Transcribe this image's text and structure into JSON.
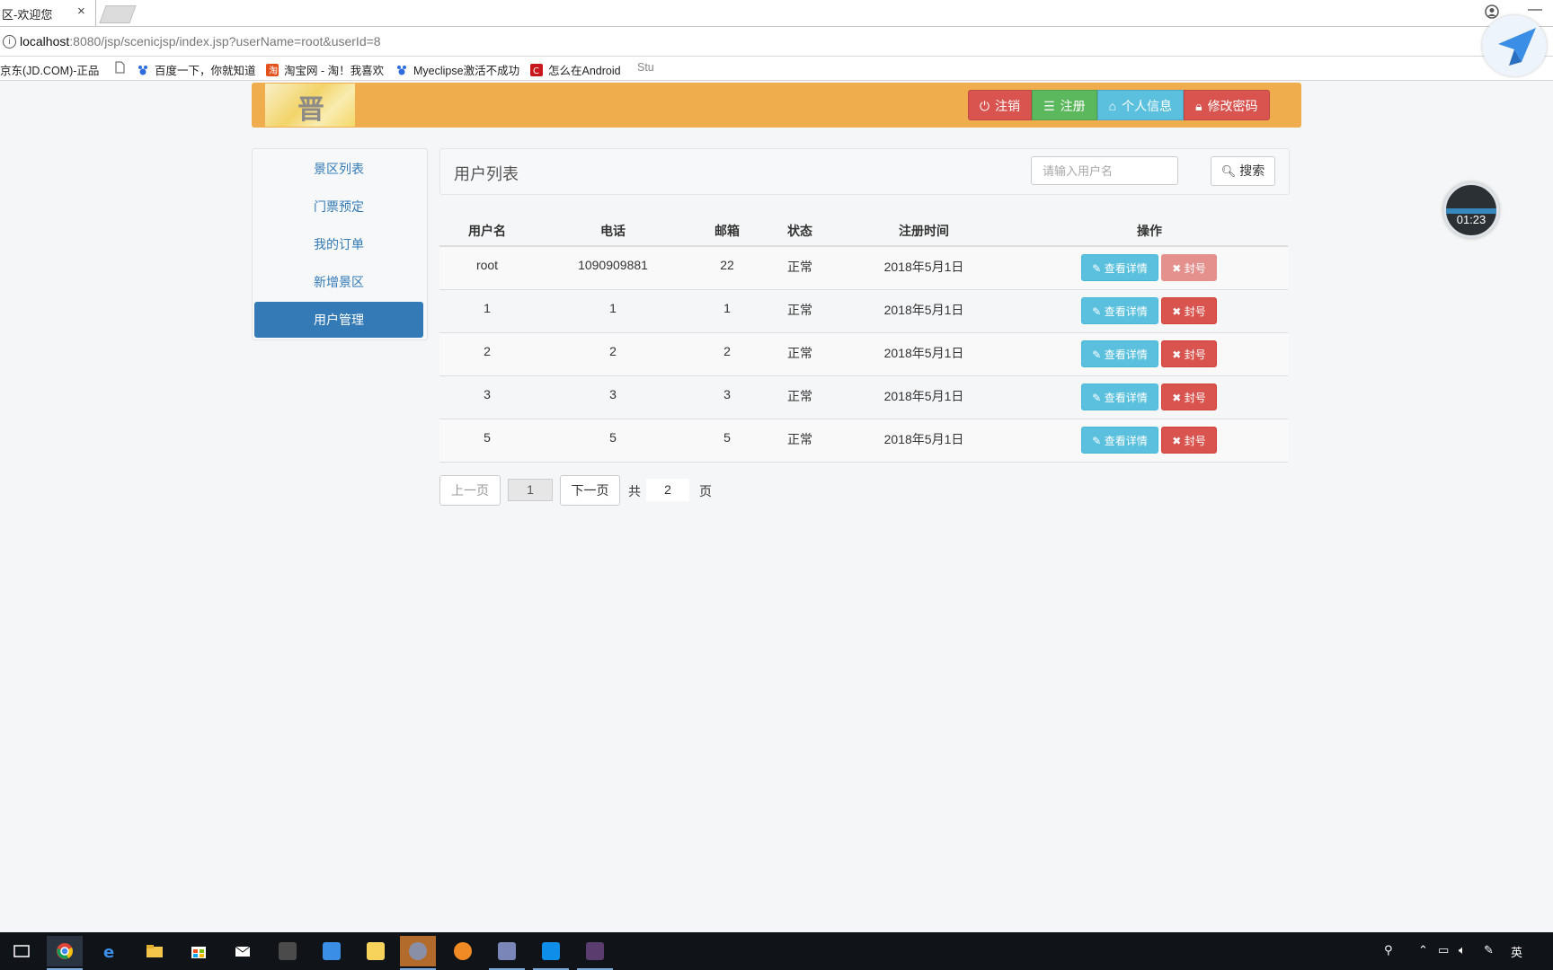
{
  "browser": {
    "tab_title": "区-欢迎您",
    "tab_close": "×",
    "url_host": "localhost",
    "url_rest": ":8080/jsp/scenicjsp/index.jsp?userName=root&userId=8",
    "bookmarks": [
      {
        "label": "京东(JD.COM)-正品",
        "icon": "jd-icon"
      },
      {
        "label": "",
        "icon": "page-icon"
      },
      {
        "label": "百度一下，你就知道",
        "icon": "baidu-icon"
      },
      {
        "label": "淘宝网 - 淘！我喜欢",
        "icon": "taobao-icon"
      },
      {
        "label": "Myeclipse激活不成功",
        "icon": "baidu-icon"
      },
      {
        "label": "怎么在Android",
        "icon": "csdn-icon"
      },
      {
        "label": "Stu",
        "icon": ""
      }
    ]
  },
  "timer": {
    "text": "01:23"
  },
  "header": {
    "logo_char": "晋",
    "buttons": {
      "logout": "注销",
      "register": "注册",
      "profile": "个人信息",
      "password": "修改密码"
    }
  },
  "sidebar": {
    "items": [
      {
        "label": "景区列表"
      },
      {
        "label": "门票预定"
      },
      {
        "label": "我的订单"
      },
      {
        "label": "新增景区"
      },
      {
        "label": "用户管理"
      }
    ],
    "active_index": 4
  },
  "panel": {
    "title": "用户列表",
    "search_placeholder": "请输入用户名",
    "search_button": "搜索"
  },
  "table": {
    "headers": [
      "用户名",
      "电话",
      "邮箱",
      "状态",
      "注册时间",
      "操作"
    ],
    "rows": [
      {
        "username": "root",
        "phone": "1090909881",
        "email": "22",
        "status": "正常",
        "date": "2018年5月1日",
        "ban_disabled": true
      },
      {
        "username": "1",
        "phone": "1",
        "email": "1",
        "status": "正常",
        "date": "2018年5月1日",
        "ban_disabled": false
      },
      {
        "username": "2",
        "phone": "2",
        "email": "2",
        "status": "正常",
        "date": "2018年5月1日",
        "ban_disabled": false
      },
      {
        "username": "3",
        "phone": "3",
        "email": "3",
        "status": "正常",
        "date": "2018年5月1日",
        "ban_disabled": false
      },
      {
        "username": "5",
        "phone": "5",
        "email": "5",
        "status": "正常",
        "date": "2018年5月1日",
        "ban_disabled": false
      }
    ],
    "detail_label": "查看详情",
    "ban_label": "封号"
  },
  "pagination": {
    "prev": "上一页",
    "current": "1",
    "next": "下一页",
    "total_prefix": "共",
    "total": "2",
    "total_suffix": "页"
  },
  "colors": {
    "header": "#f0ad4e",
    "primary": "#337ab7",
    "danger": "#d9534f",
    "success": "#5cb85c",
    "info": "#5bc0de"
  }
}
